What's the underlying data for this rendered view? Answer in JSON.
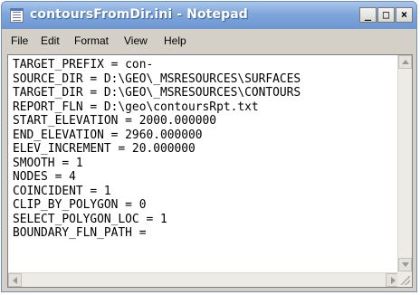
{
  "window": {
    "title": "contoursFromDir.ini - Notepad",
    "controls": {
      "minimize": "_",
      "maximize": "□",
      "close": "×"
    }
  },
  "menu": {
    "items": [
      "File",
      "Edit",
      "Format",
      "View",
      "Help"
    ]
  },
  "editor": {
    "lines": [
      "TARGET_PREFIX = con-",
      "SOURCE_DIR = D:\\GEO\\_MSRESOURCES\\SURFACES",
      "TARGET_DIR = D:\\GEO\\_MSRESOURCES\\CONTOURS",
      "REPORT_FLN = D:\\geo\\contoursRpt.txt",
      "START_ELEVATION = 2000.000000",
      "END_ELEVATION = 2960.000000",
      "ELEV_INCREMENT = 20.000000",
      "SMOOTH = 1",
      "NODES = 4",
      "COINCIDENT = 1",
      "CLIP_BY_POLYGON = 0",
      "SELECT_POLYGON_LOC = 1",
      "BOUNDARY_FLN_PATH ="
    ]
  },
  "icons": {
    "app": "notepad-icon",
    "scroll_up": "arrow-up-icon",
    "scroll_down": "arrow-down-icon",
    "scroll_left": "arrow-left-icon",
    "scroll_right": "arrow-right-icon",
    "resize": "resize-grip-icon"
  },
  "colors": {
    "titlebar": "#7fa6db",
    "chrome": "#d4d0c8",
    "editor_bg": "#ffffff"
  }
}
